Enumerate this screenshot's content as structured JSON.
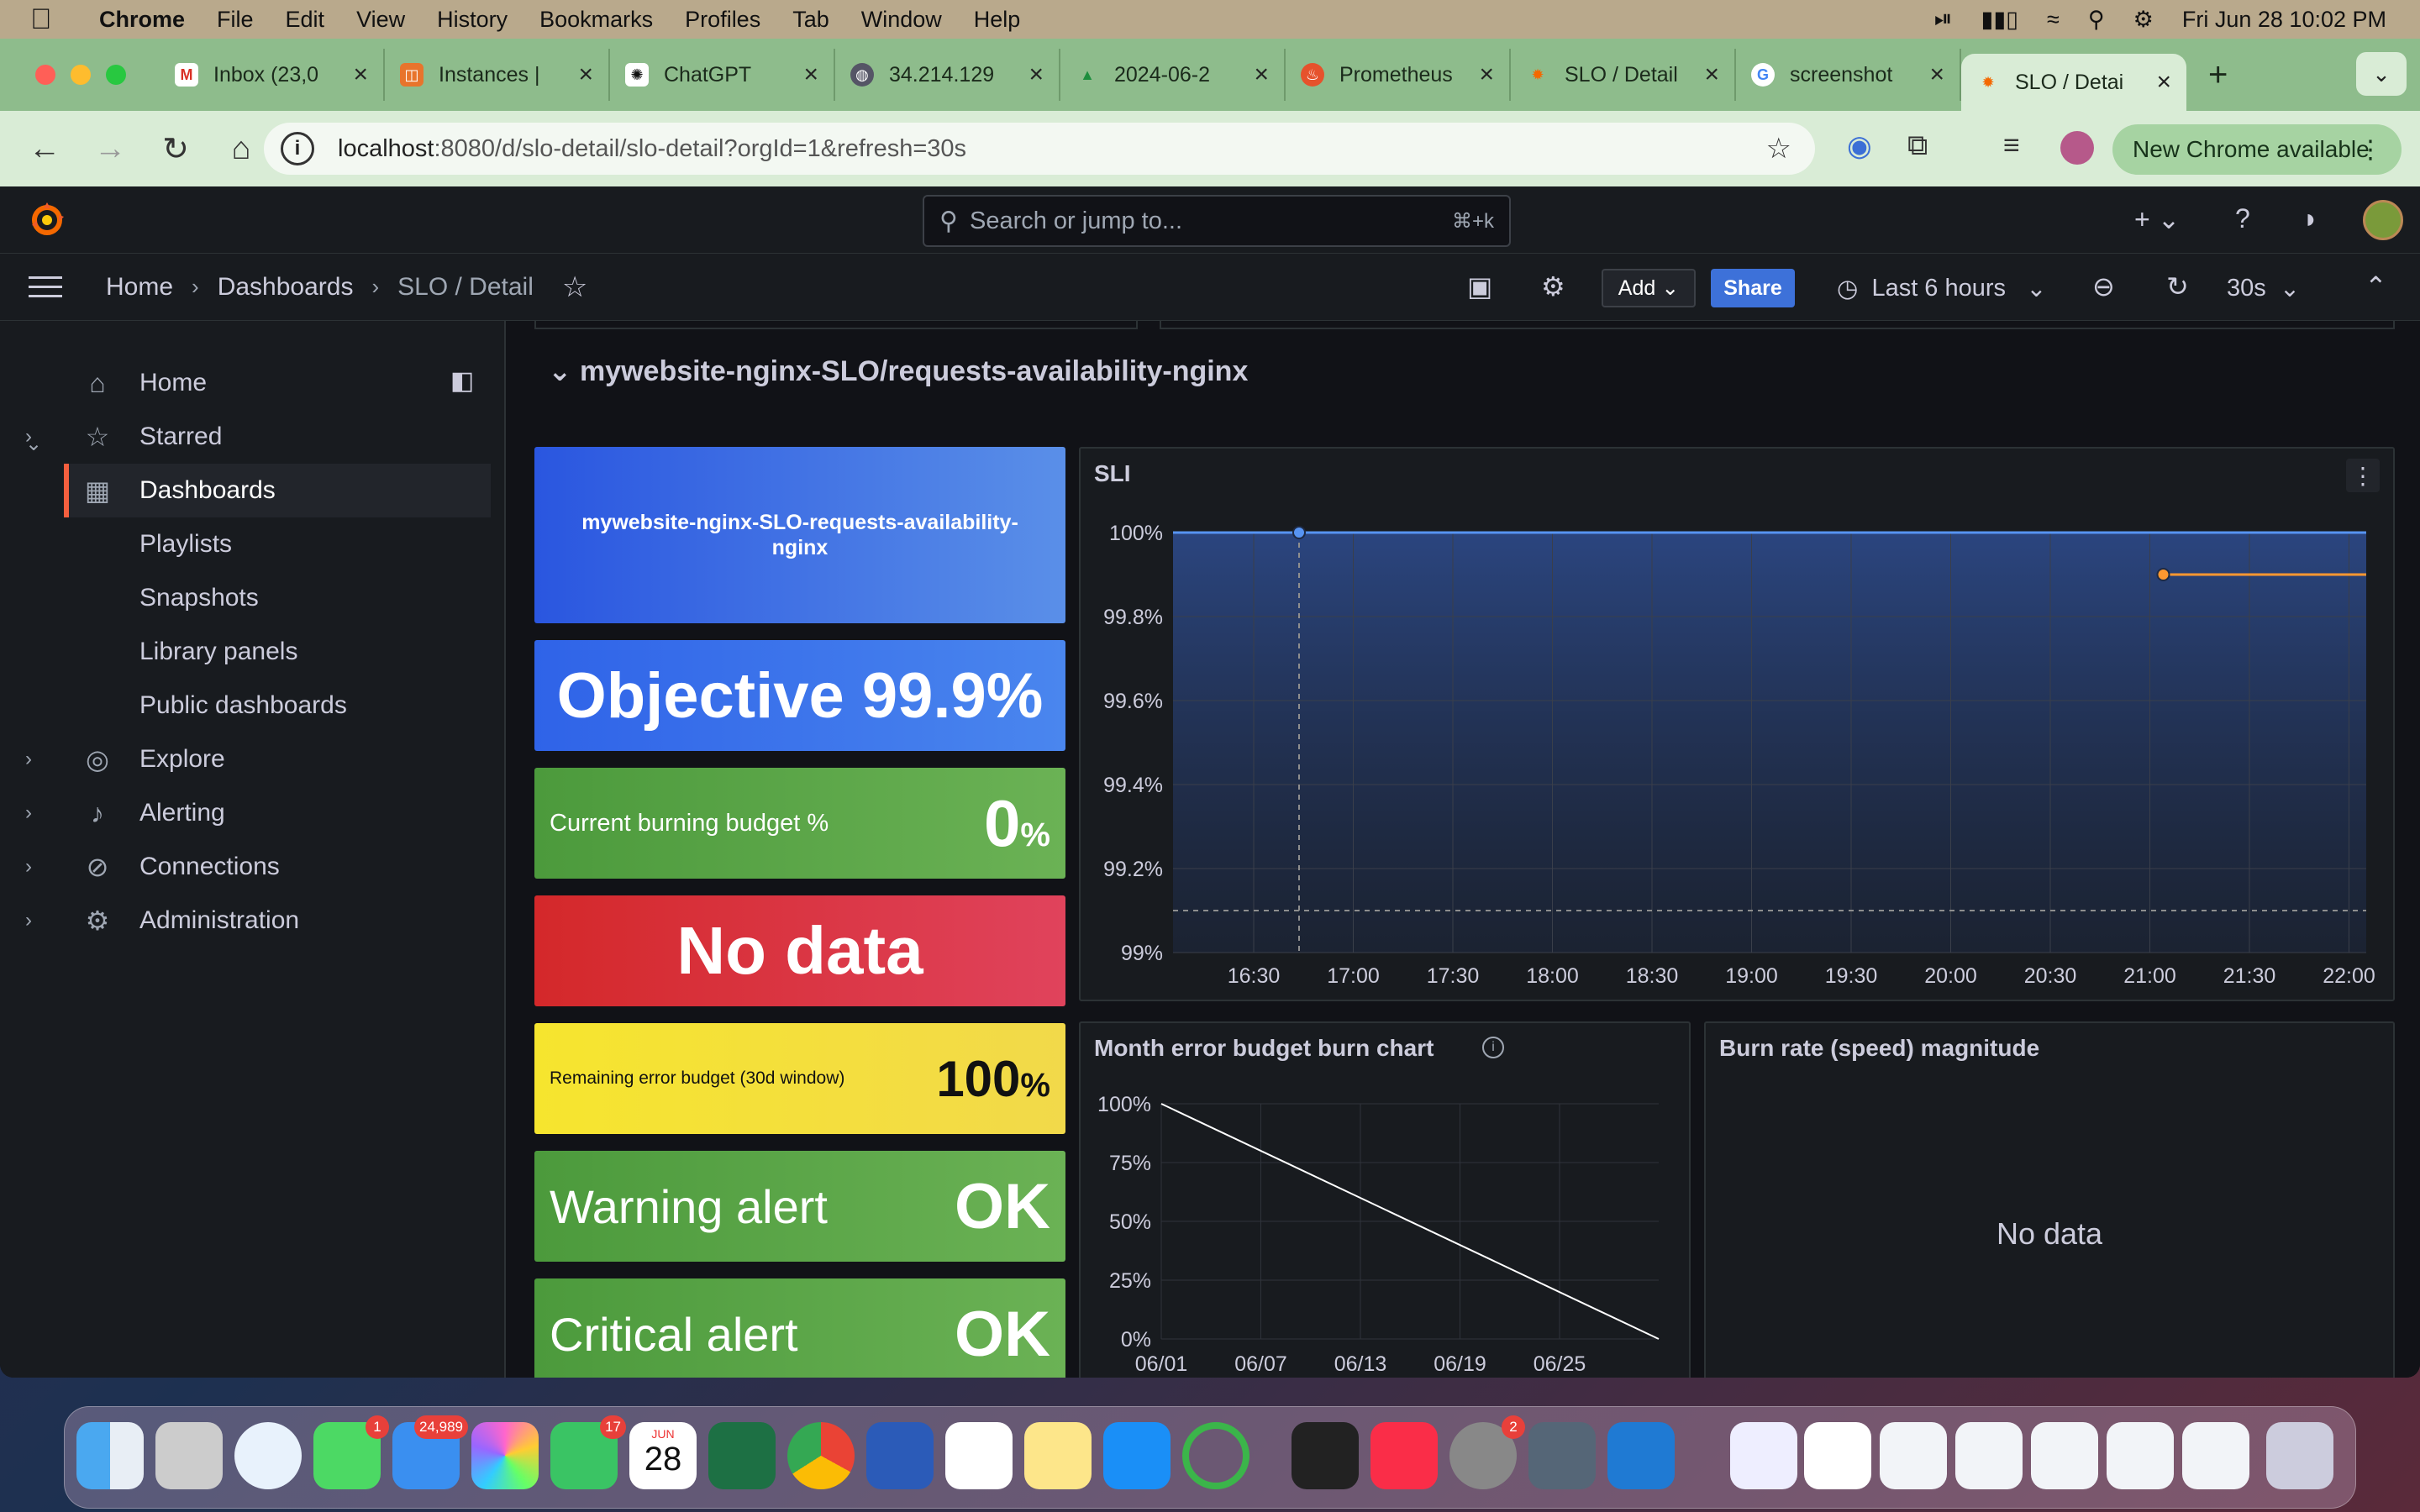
{
  "menubar": {
    "app": "Chrome",
    "items": [
      "File",
      "Edit",
      "View",
      "History",
      "Bookmarks",
      "Profiles",
      "Tab",
      "Window",
      "Help"
    ],
    "datetime": "Fri Jun 28  10:02 PM"
  },
  "tabs": [
    {
      "title": "Inbox (23,0",
      "icon": "gmail-icon"
    },
    {
      "title": "Instances |",
      "icon": "instances-icon"
    },
    {
      "title": "ChatGPT",
      "icon": "chatgpt-icon"
    },
    {
      "title": "34.214.129",
      "icon": "globe-icon"
    },
    {
      "title": "2024-06-2",
      "icon": "drive-icon"
    },
    {
      "title": "Prometheus",
      "icon": "prometheus-icon"
    },
    {
      "title": "SLO / Detail",
      "icon": "grafana-icon"
    },
    {
      "title": "screenshot",
      "icon": "google-icon"
    },
    {
      "title": "SLO / Detai",
      "icon": "grafana-icon",
      "active": true
    }
  ],
  "browser": {
    "url_host": "localhost",
    "url_path": ":8080/d/slo-detail/slo-detail?orgId=1&refresh=30s",
    "update_label": "New Chrome available"
  },
  "grafana": {
    "search_placeholder": "Search or jump to...",
    "search_shortcut": "⌘+k",
    "breadcrumb": [
      "Home",
      "Dashboards",
      "SLO / Detail"
    ],
    "add_label": "Add",
    "share_label": "Share",
    "time_range": "Last 6 hours",
    "refresh_interval": "30s",
    "accent": "#f55f3e"
  },
  "sidenav": {
    "items": [
      {
        "label": "Home",
        "icon": "home-icon"
      },
      {
        "label": "Starred",
        "icon": "star-icon"
      },
      {
        "label": "Dashboards",
        "icon": "dashboards-icon"
      },
      {
        "label": "Playlists"
      },
      {
        "label": "Snapshots"
      },
      {
        "label": "Library panels"
      },
      {
        "label": "Public dashboards"
      },
      {
        "label": "Explore",
        "icon": "compass-icon"
      },
      {
        "label": "Alerting",
        "icon": "bell-icon"
      },
      {
        "label": "Connections",
        "icon": "connections-icon"
      },
      {
        "label": "Administration",
        "icon": "gear-icon"
      }
    ]
  },
  "dashboard": {
    "row_title": "mywebsite-nginx-SLO/requests-availability-nginx",
    "slo_name": "mywebsite-nginx-SLO-requests-availability-nginx",
    "objective": "Objective 99.9%",
    "burning_label": "Current burning budget %",
    "burning_value": "0",
    "burning_unit": "%",
    "nodata_text": "No data",
    "remaining_label": "Remaining error budget (30d window)",
    "remaining_value": "100",
    "remaining_unit": "%",
    "warning_label": "Warning alert",
    "warning_value": "OK",
    "critical_label": "Critical alert",
    "critical_value": "OK",
    "sli_title": "SLI",
    "burnchart_title": "Month error budget burn chart",
    "burnrate_title": "Burn rate (speed) magnitude",
    "burnrate_nodata": "No data"
  },
  "chart_data": [
    {
      "type": "line",
      "title": "SLI",
      "x": [
        "16:30",
        "17:00",
        "17:30",
        "18:00",
        "18:30",
        "19:00",
        "19:30",
        "20:00",
        "20:30",
        "21:00",
        "21:30",
        "22:00"
      ],
      "yticks": [
        "99%",
        "99.2%",
        "99.4%",
        "99.6%",
        "99.8%",
        "100%"
      ],
      "ylim": [
        99,
        100
      ],
      "series": [
        {
          "values": [
            100,
            100,
            100,
            100,
            100,
            100,
            100,
            100,
            100,
            100,
            100,
            100
          ],
          "color": "#5794f2"
        },
        {
          "values": [
            null,
            null,
            null,
            null,
            null,
            null,
            null,
            null,
            null,
            99.9,
            99.9,
            99.9
          ],
          "color": "#ff9830"
        }
      ],
      "threshold": 99.1,
      "grid": true
    },
    {
      "type": "line",
      "title": "Month error budget burn chart",
      "x": [
        "06/01",
        "06/07",
        "06/13",
        "06/19",
        "06/25"
      ],
      "yticks": [
        "0%",
        "25%",
        "50%",
        "75%",
        "100%"
      ],
      "ylim": [
        0,
        100
      ],
      "series": [
        {
          "points": [
            [
              "06/01",
              100
            ],
            [
              "06/30",
              0
            ]
          ],
          "color": "#ffffff"
        }
      ],
      "grid": true
    }
  ],
  "dock": {
    "badges": {
      "messages": "1",
      "mail": "24,989",
      "facetime": "17",
      "settings": "2"
    },
    "calendar_month": "JUN",
    "calendar_day": "28"
  }
}
